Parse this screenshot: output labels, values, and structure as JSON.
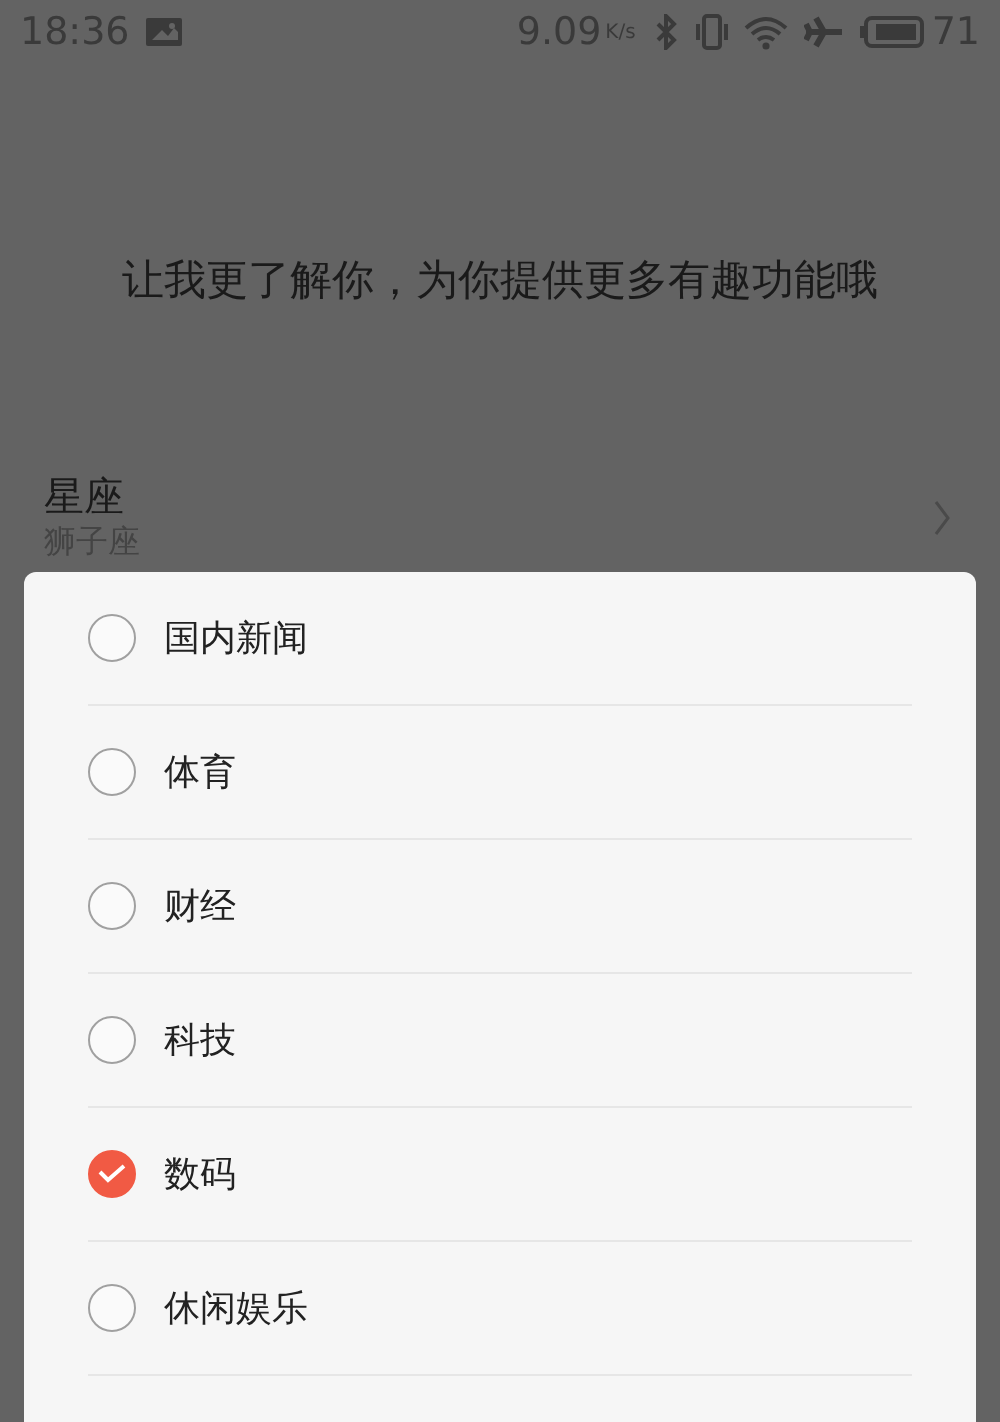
{
  "status_bar": {
    "time": "18:36",
    "speed": "9.09",
    "speed_unit": "K/s",
    "battery": "71"
  },
  "prompt": "让我更了解你，为你提供更多有趣功能哦",
  "setting": {
    "title": "星座",
    "value": "狮子座"
  },
  "dialog": {
    "options": [
      {
        "label": "国内新闻",
        "checked": false
      },
      {
        "label": "体育",
        "checked": false
      },
      {
        "label": "财经",
        "checked": false
      },
      {
        "label": "科技",
        "checked": false
      },
      {
        "label": "数码",
        "checked": true
      },
      {
        "label": "休闲娱乐",
        "checked": false
      }
    ]
  }
}
